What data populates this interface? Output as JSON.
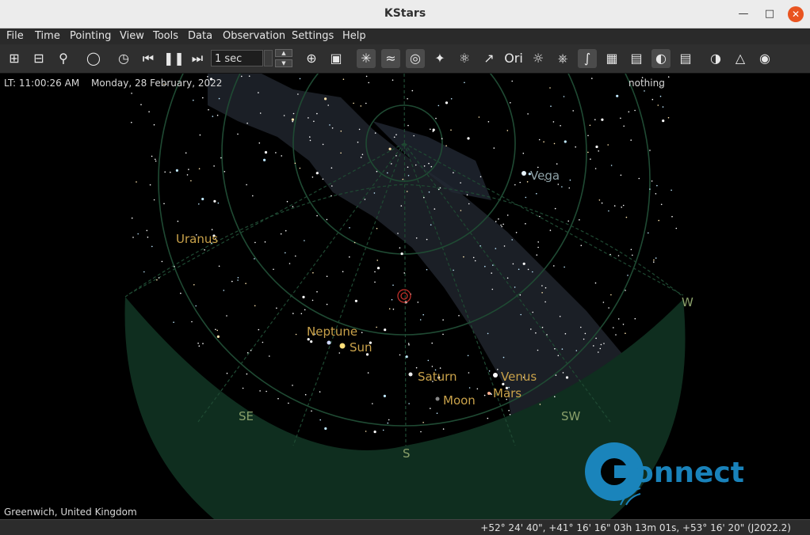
{
  "window": {
    "title": "KStars"
  },
  "menu": [
    "File",
    "Time",
    "Pointing",
    "View",
    "Tools",
    "Data",
    "Observation",
    "Settings",
    "Help"
  ],
  "toolbar": {
    "time_step": "1 sec"
  },
  "sky": {
    "local_time": "LT: 11:00:26 AM",
    "date": "Monday, 28 February, 2022",
    "focus_object": "nothing",
    "location": "Greenwich, United Kingdom",
    "labels": {
      "vega": "Vega",
      "uranus": "Uranus",
      "neptune": "Neptune",
      "sun": "Sun",
      "saturn": "Saturn",
      "venus": "Venus",
      "mars": "Mars",
      "moon": "Moon",
      "w": "W",
      "se": "SE",
      "sw": "SW",
      "s": "S"
    },
    "colors": {
      "planet_label": "#c9a24a",
      "horizon": "#0f2e1f",
      "milky_way": "#1c2128",
      "compass": "#8aa06a"
    }
  },
  "watermark": {
    "text": "onnect"
  },
  "status": {
    "coordinates": "+52° 24' 40\", +41° 16' 16\"  03h 13m 01s, +53° 16' 20\" (J2022.2)"
  }
}
